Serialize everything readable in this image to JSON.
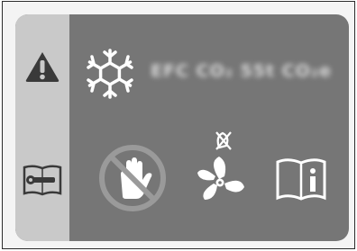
{
  "label": {
    "text": "EFC  CO₂  55t CO₂e"
  },
  "icons": [
    {
      "name": "warning-icon",
      "meaning": "warning"
    },
    {
      "name": "wrench-manual-icon",
      "meaning": "service manual"
    },
    {
      "name": "snowflake-icon",
      "meaning": "refrigerant / cold"
    },
    {
      "name": "no-touch-hand-icon",
      "meaning": "do not touch"
    },
    {
      "name": "fan-icon",
      "meaning": "fan"
    },
    {
      "name": "info-book-icon",
      "meaning": "read instructions"
    }
  ],
  "colors": {
    "panel": "#767676",
    "strip": "#c9c9c9",
    "icon_dark": "#3a3a3a",
    "icon_light": "#ffffff"
  }
}
